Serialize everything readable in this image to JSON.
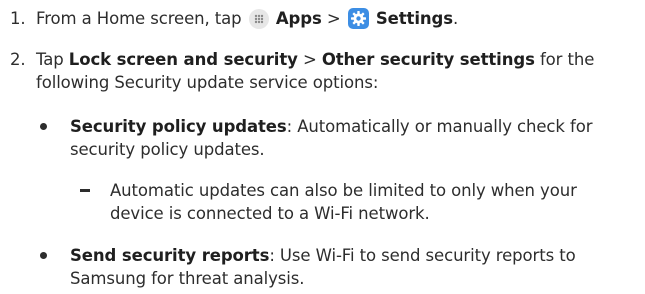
{
  "steps": [
    {
      "number": "1.",
      "prefix": "From a Home screen, tap",
      "apps_label": "Apps",
      "separator": ">",
      "settings_label": "Settings",
      "suffix": ".",
      "icons": [
        "apps-grid-icon",
        "settings-gear-icon"
      ]
    },
    {
      "number": "2.",
      "prefix": "Tap",
      "lock_label": "Lock screen and security",
      "separator": ">",
      "other_label": "Other security settings",
      "mid": "for the",
      "line2": "following Security update service options:"
    }
  ],
  "bullets": [
    {
      "title": "Security policy updates",
      "text_line1": ": Automatically or manually check for",
      "text_line2": "security policy updates.",
      "sub": {
        "line1": "Automatic updates can also be limited to only when your",
        "line2": "device is connected to a Wi-Fi network."
      }
    },
    {
      "title": "Send security reports",
      "text_line1": ": Use Wi-Fi to send security reports to",
      "text_line2": "Samsung for threat analysis."
    }
  ],
  "colors": {
    "text": "#2d2d2d",
    "settings_icon_bg": "#3d8ee4",
    "apps_icon_bg": "#e7e7e7"
  }
}
